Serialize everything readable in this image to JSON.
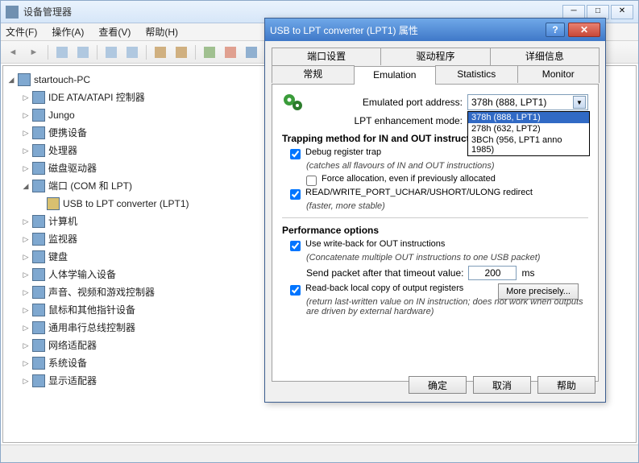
{
  "window": {
    "title": "设备管理器",
    "minimize": "─",
    "maximize": "□",
    "close_tip": "✕"
  },
  "menu": {
    "file": "文件(F)",
    "action": "操作(A)",
    "view": "查看(V)",
    "help": "帮助(H)"
  },
  "tree": {
    "root": "startouch-PC",
    "items": [
      "IDE ATA/ATAPI 控制器",
      "Jungo",
      "便携设备",
      "处理器",
      "磁盘驱动器",
      "端口 (COM 和 LPT)",
      "计算机",
      "监视器",
      "键盘",
      "人体学输入设备",
      "声音、视频和游戏控制器",
      "鼠标和其他指针设备",
      "通用串行总线控制器",
      "网络适配器",
      "系统设备",
      "显示适配器"
    ],
    "port_child": "USB to LPT converter (LPT1)"
  },
  "dialog": {
    "title": "USB to LPT converter (LPT1) 属性",
    "help_btn": "?",
    "close_btn": "✕",
    "tabs_row1": [
      "端口设置",
      "驱动程序",
      "详细信息"
    ],
    "tabs_row2": [
      "常规",
      "Emulation",
      "Statistics",
      "Monitor"
    ],
    "emulated_label": "Emulated port address:",
    "emulated_value": "378h (888, LPT1)",
    "dropdown": [
      "378h (888, LPT1)",
      "278h (632, LPT2)",
      "3BCh (956, LPT1 anno 1985)"
    ],
    "enhancement_label": "LPT enhancement mode:",
    "trapping_header": "Trapping method for IN and OUT instructions",
    "debug_trap": "Debug register trap",
    "debug_sub": "(catches all flavours of IN and OUT instructions)",
    "force_alloc": "Force allocation, even if previously allocated",
    "readwrite": "READ/WRITE_PORT_UCHAR/USHORT/ULONG redirect",
    "readwrite_sub": "(faster, more stable)",
    "perf_header": "Performance options",
    "writeback": "Use write-back for OUT instructions",
    "writeback_sub": "(Concatenate multiple OUT instructions to one USB packet)",
    "timeout_label": "Send packet after that timeout value:",
    "timeout_value": "200",
    "timeout_unit": "ms",
    "readback": "Read-back local copy of output registers",
    "readback_sub": "(return last-written value on IN instruction; does not work when outputs are driven by external hardware)",
    "more_precisely": "More precisely...",
    "ok": "确定",
    "cancel": "取消",
    "help": "帮助"
  }
}
